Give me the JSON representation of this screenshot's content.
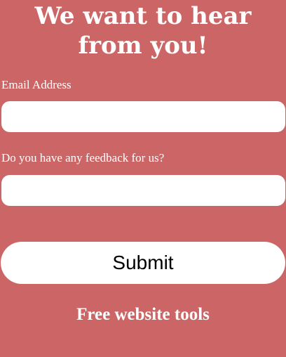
{
  "form": {
    "title": "We want to hear from you!",
    "email": {
      "label": "Email Address",
      "value": "",
      "placeholder": ""
    },
    "feedback": {
      "label": "Do you have any feedback for us?",
      "value": "",
      "placeholder": ""
    },
    "submit_label": "Submit"
  },
  "footer": {
    "link_text": "Free website tools"
  },
  "colors": {
    "background": "#cc6666",
    "text": "#ffffff",
    "field_background": "#ffffff",
    "button_text": "#000000"
  }
}
